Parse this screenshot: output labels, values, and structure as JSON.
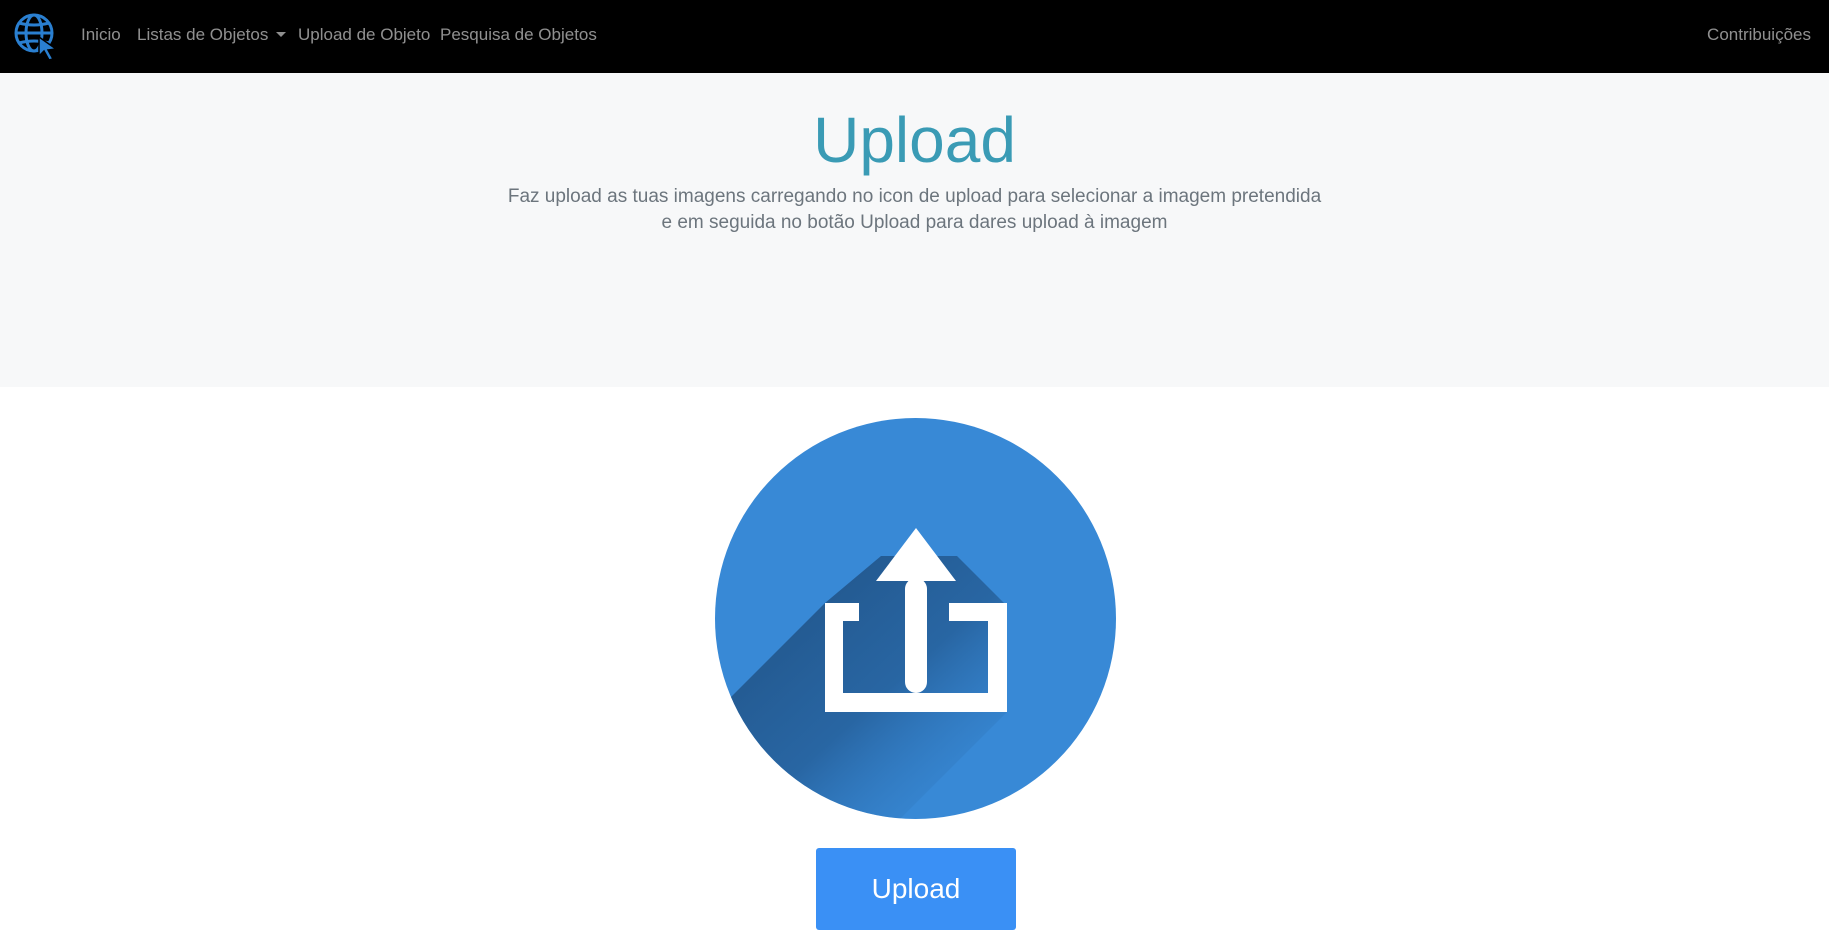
{
  "navbar": {
    "brand_icon": "globe-cursor-icon",
    "items": [
      {
        "label": "Inicio"
      },
      {
        "label": "Listas de Objetos"
      },
      {
        "label": "Upload de Objeto"
      },
      {
        "label": "Pesquisa de Objetos"
      }
    ],
    "right_link": "Contribuições"
  },
  "hero": {
    "title": "Upload",
    "line1": "Faz upload as tuas imagens carregando no icon de upload para selecionar a imagem pretendida",
    "line2": "e em seguida no botão Upload para dares upload à imagem"
  },
  "upload": {
    "icon": "upload-icon",
    "button_label": "Upload"
  },
  "colors": {
    "navbar_bg": "#000000",
    "hero_bg": "#f7f8f9",
    "title": "#3a9bb5",
    "accent": "#3a90f5",
    "icon_circle": "#3889d6"
  }
}
